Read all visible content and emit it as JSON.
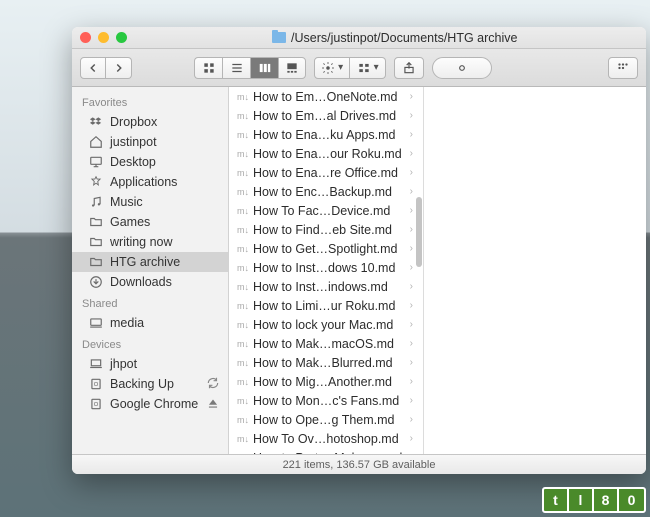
{
  "window": {
    "title_path": "/Users/justinpot/Documents/HTG archive"
  },
  "sidebar": {
    "sections": [
      {
        "header": "Favorites",
        "items": [
          {
            "icon": "dropbox",
            "label": "Dropbox",
            "selected": false
          },
          {
            "icon": "home",
            "label": "justinpot",
            "selected": false
          },
          {
            "icon": "desktop",
            "label": "Desktop",
            "selected": false
          },
          {
            "icon": "apps",
            "label": "Applications",
            "selected": false
          },
          {
            "icon": "music",
            "label": "Music",
            "selected": false
          },
          {
            "icon": "folder",
            "label": "Games",
            "selected": false
          },
          {
            "icon": "folder",
            "label": "writing now",
            "selected": false
          },
          {
            "icon": "folder",
            "label": "HTG archive",
            "selected": true
          },
          {
            "icon": "downloads",
            "label": "Downloads",
            "selected": false
          }
        ]
      },
      {
        "header": "Shared",
        "items": [
          {
            "icon": "computer",
            "label": "media",
            "selected": false
          }
        ]
      },
      {
        "header": "Devices",
        "items": [
          {
            "icon": "laptop",
            "label": "jhpot",
            "selected": false
          },
          {
            "icon": "disk",
            "label": "Backing Up",
            "selected": false,
            "sync": true
          },
          {
            "icon": "disk",
            "label": "Google Chrome",
            "selected": false,
            "eject": true
          }
        ]
      }
    ]
  },
  "files": [
    "How to Em…OneNote.md",
    "How to Em…al Drives.md",
    "How to Ena…ku Apps.md",
    "How to Ena…our Roku.md",
    "How to Ena…re Office.md",
    "How to Enc…Backup.md",
    "How To Fac…Device.md",
    "How to Find…eb Site.md",
    "How to Get…Spotlight.md",
    "How to Inst…dows 10.md",
    "How to Inst…indows.md",
    "How to Limi…ur Roku.md",
    "How to lock your Mac.md",
    "How to Mak…macOS.md",
    "How to Mak…Blurred.md",
    "How to Mig…Another.md",
    "How to Mon…c's Fans.md",
    "How to Ope…g Them.md",
    "How To Ov…hotoshop.md",
    "How to Prot… Malware.md"
  ],
  "status": {
    "text": "221 items, 136.57 GB available"
  },
  "logo": {
    "c1": "t",
    "c2": "l",
    "c3": "8",
    "c4": "0"
  }
}
